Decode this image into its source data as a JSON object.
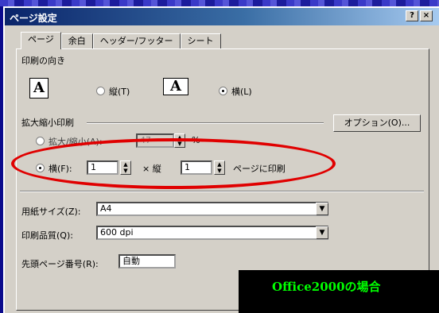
{
  "window": {
    "title": "ページ設定",
    "help_button": "?",
    "close_button": "×"
  },
  "tabs": [
    {
      "label": "ページ"
    },
    {
      "label": "余白"
    },
    {
      "label": "ヘッダー/フッター"
    },
    {
      "label": "シート"
    }
  ],
  "orientation": {
    "section_label": "印刷の向き",
    "portrait_label": "縦(T)",
    "landscape_label": "横(L)",
    "portrait_icon_letter": "A",
    "landscape_icon_letter": "A",
    "selected": "landscape"
  },
  "scaling": {
    "section_label": "拡大縮小印刷",
    "scale_label": "拡大/縮小(A):",
    "scale_value": "47",
    "scale_unit": "%",
    "fit_label": "横(F):",
    "fit_wide_value": "1",
    "fit_times": "× 縦",
    "fit_tall_value": "1",
    "fit_suffix": "ページに印刷",
    "selected": "fit",
    "options_button": "オプション(O)..."
  },
  "paper": {
    "size_label": "用紙サイズ(Z):",
    "size_value": "A4"
  },
  "quality": {
    "label": "印刷品質(Q):",
    "value": "600 dpi"
  },
  "first_page": {
    "label": "先頭ページ番号(R):",
    "value": "自動"
  },
  "overlay": {
    "banner_text": "Office2000の場合"
  },
  "colors": {
    "highlight_oval": "#e00000",
    "banner_text": "#00ff00",
    "title_bar": "#0a246a"
  }
}
